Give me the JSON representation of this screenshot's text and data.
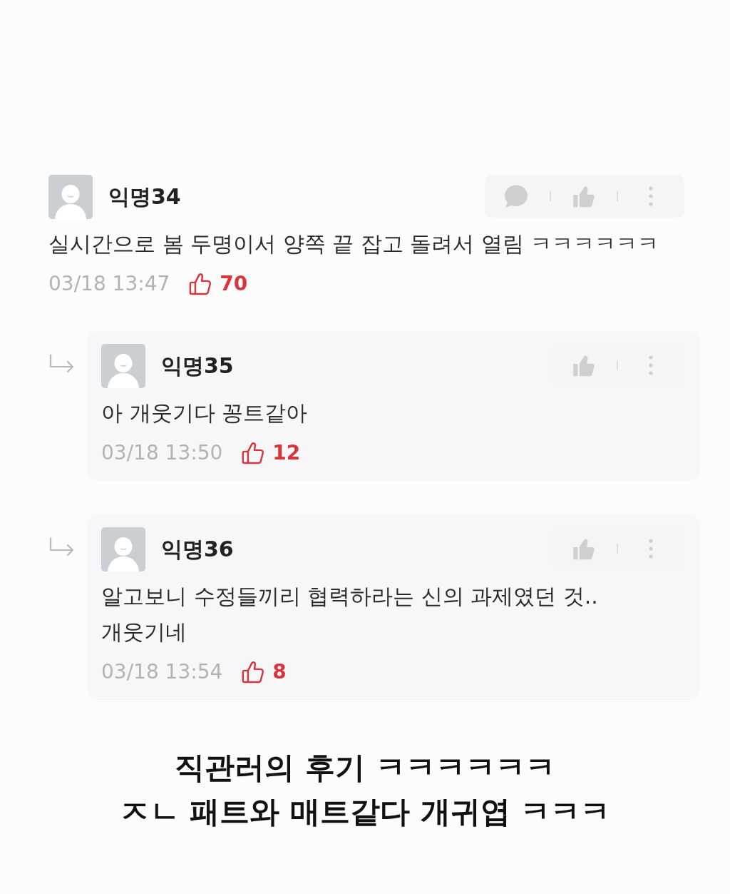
{
  "comments": [
    {
      "author": "익명34",
      "text": "실시간으로 봄 두명이서 양쪽 끝 잡고 돌려서 열림 ㅋㅋㅋㅋㅋㅋ",
      "date": "03/18 13:47",
      "likes": "70",
      "actions": [
        {
          "kind": "comment"
        },
        {
          "kind": "like"
        },
        {
          "kind": "more"
        }
      ],
      "replies": [
        {
          "author": "익명35",
          "text": "아 개웃기다 꽁트같아",
          "date": "03/18 13:50",
          "likes": "12",
          "actions": [
            {
              "kind": "like"
            },
            {
              "kind": "more"
            }
          ]
        },
        {
          "author": "익명36",
          "text": "알고보니 수정들끼리 협력하라는 신의 과제였던 것..\n개웃기네",
          "date": "03/18 13:54",
          "likes": "8",
          "actions": [
            {
              "kind": "like"
            },
            {
              "kind": "more"
            }
          ]
        }
      ]
    }
  ],
  "caption": {
    "lines": [
      "직관러의 후기 ㅋㅋㅋㅋㅋㅋ",
      "ㅈㄴ 패트와 매트같다 개귀엽 ㅋㅋㅋ"
    ]
  }
}
